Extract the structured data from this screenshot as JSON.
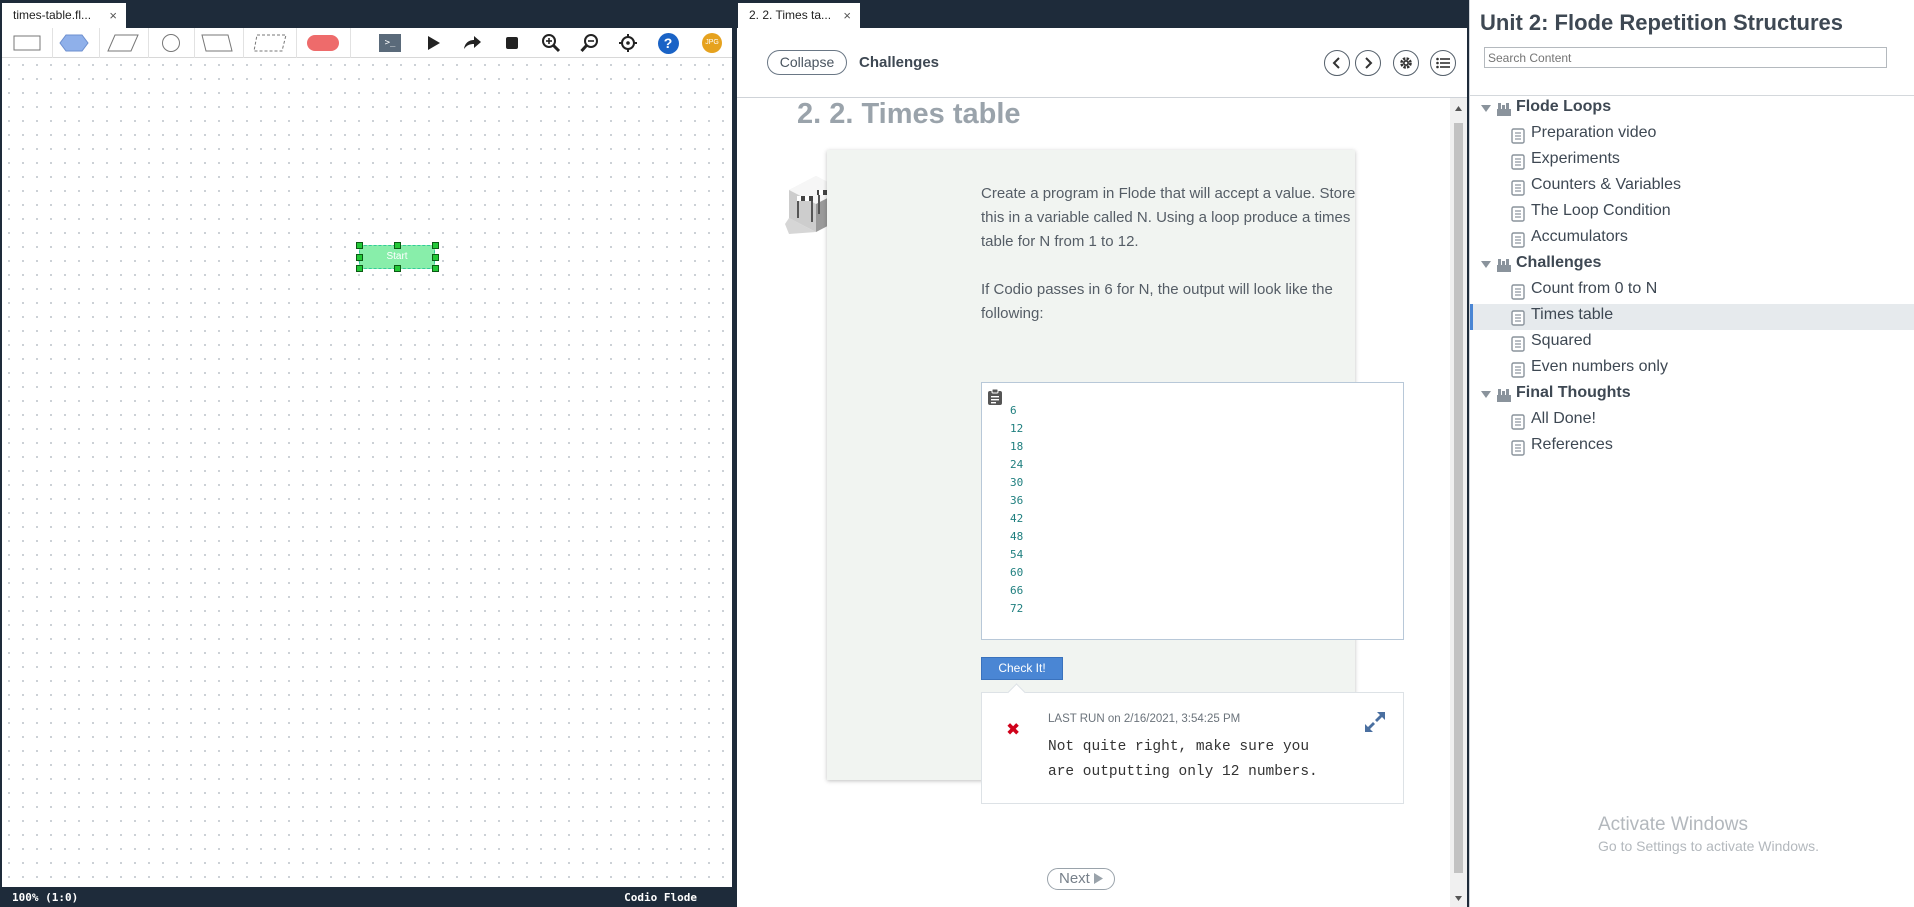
{
  "flow_editor": {
    "tab": {
      "label": "times-table.fl...",
      "close": "×"
    },
    "toolbar": {
      "tools": [
        "process-shape",
        "decision-shape",
        "input-output-shape",
        "connector-shape",
        "manual-input-shape",
        "document-shape",
        "terminal-shape"
      ],
      "actions": [
        "console-icon",
        "play-icon",
        "step-icon",
        "stop-icon",
        "zoom-in-icon",
        "zoom-out-icon",
        "center-icon",
        "help-icon",
        "export-jpg-icon"
      ],
      "console_glyph": ">_",
      "help_glyph": "?",
      "jpg_label": "JPG"
    },
    "node": {
      "label": "Start"
    },
    "status": {
      "zoom": "100% (1:0)",
      "brand": "Codio Flode"
    }
  },
  "guide": {
    "tab": {
      "label": "2. 2. Times ta...",
      "close": "×"
    },
    "header": {
      "collapse_label": "Collapse",
      "section_label": "Challenges"
    },
    "page_title": "2. 2. Times table",
    "description": [
      "Create a program in Flode that will accept a value. Store this in a variable called N. Using a loop produce a times table for N from 1 to 12.",
      "If Codio passes in 6 for N, the output will look like the following:"
    ],
    "expected_output": [
      "6",
      "12",
      "18",
      "24",
      "30",
      "36",
      "42",
      "48",
      "54",
      "60",
      "66",
      "72"
    ],
    "check_button": "Check It!",
    "result": {
      "status": "fail",
      "last_run_label": "LAST RUN",
      "last_run_time": "on 2/16/2021, 3:54:25 PM",
      "message_line1": "Not quite right, make sure you",
      "message_line2": "are outputting only 12 numbers.",
      "fail_glyph": "✖"
    },
    "next_label": "Next"
  },
  "toc": {
    "title": "Unit 2: Flode Repetition Structures",
    "search_placeholder": "Search Content",
    "sections": [
      {
        "title": "Flode Loops",
        "items": [
          "Preparation video",
          "Experiments",
          "Counters & Variables",
          "The Loop Condition",
          "Accumulators"
        ]
      },
      {
        "title": "Challenges",
        "items": [
          "Count from 0 to N",
          "Times table",
          "Squared",
          "Even numbers only"
        ]
      },
      {
        "title": "Final Thoughts",
        "items": [
          "All Done!",
          "References"
        ]
      }
    ],
    "active_item": "Times table"
  },
  "watermark": {
    "title": "Activate Windows",
    "subtitle": "Go to Settings to activate Windows."
  },
  "colors": {
    "accent": "#4a86d4",
    "node_fill": "#88eeaa",
    "handle": "#23c837",
    "fail": "#d0021b",
    "dark_bg": "#1e2b3a"
  }
}
